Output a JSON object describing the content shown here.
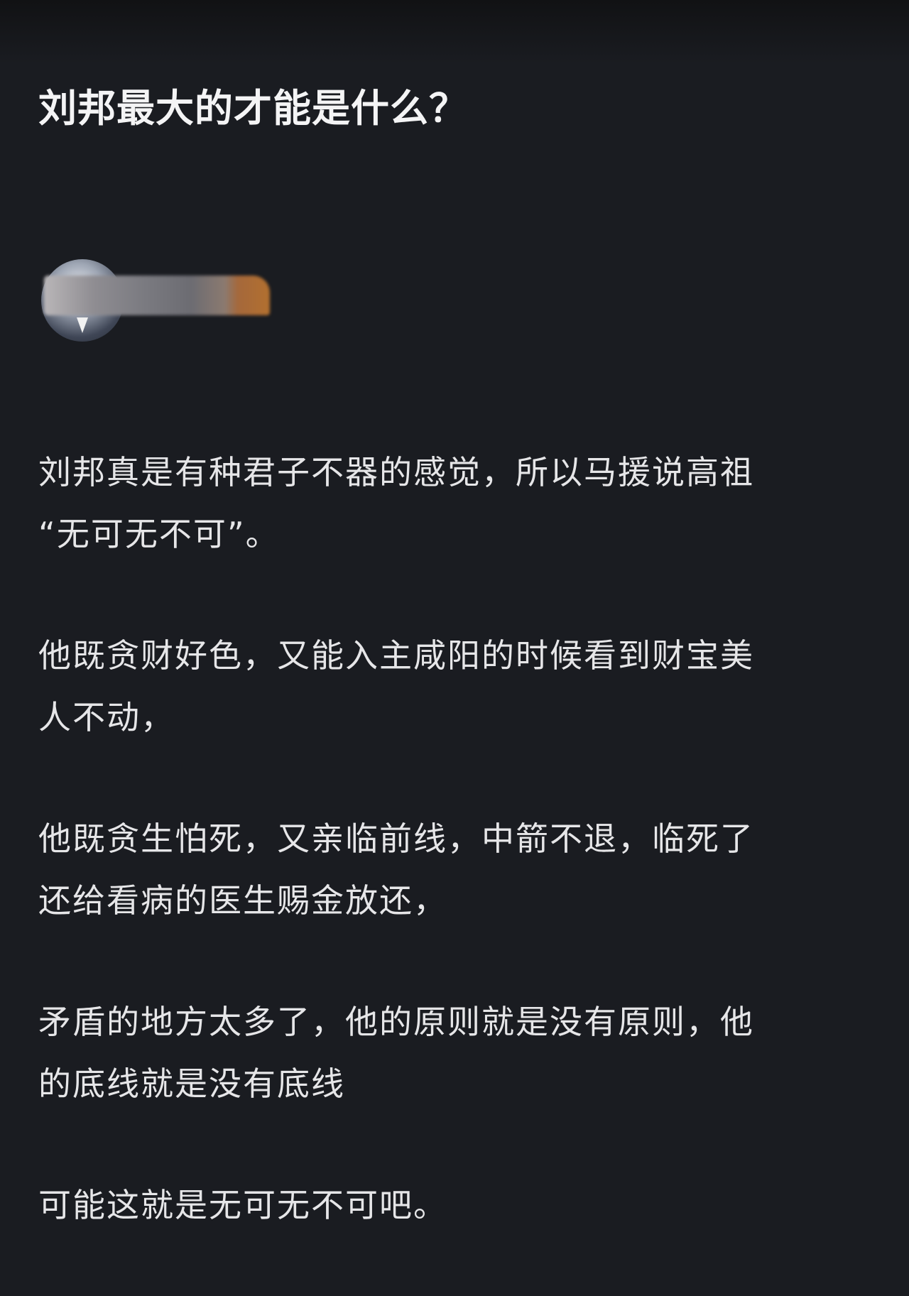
{
  "question": {
    "title": "刘邦最大的才能是什么？"
  },
  "author": {
    "avatar_icon": "user-avatar",
    "name_redacted": true
  },
  "answer": {
    "paragraphs": [
      [
        "刘邦真是有种君子不器的感觉，所以马援说高祖",
        "“无可无不可”。"
      ],
      [
        "他既贪财好色，又能入主咸阳的时候看到财宝美",
        "人不动，"
      ],
      [
        "他既贪生怕死，又亲临前线，中箭不退，临死了",
        "还给看病的医生赐金放还，"
      ],
      [
        "矛盾的地方太多了，他的原则就是没有原则，他",
        "的底线就是没有底线"
      ],
      [
        "可能这就是无可无不可吧。"
      ]
    ]
  },
  "colors": {
    "background": "#1a1c21",
    "text": "#e6e6e8"
  }
}
